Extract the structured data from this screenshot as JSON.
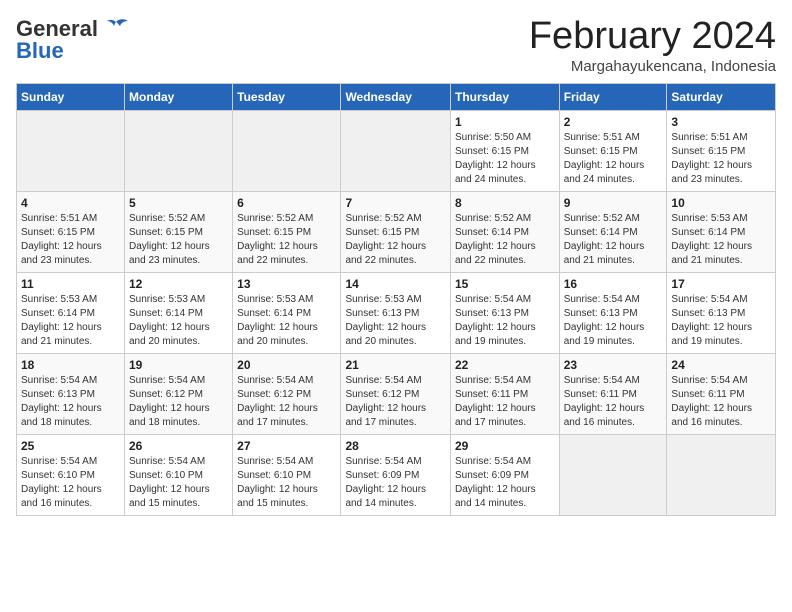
{
  "header": {
    "logo_general": "General",
    "logo_blue": "Blue",
    "month_title": "February 2024",
    "subtitle": "Margahayukencana, Indonesia"
  },
  "days_of_week": [
    "Sunday",
    "Monday",
    "Tuesday",
    "Wednesday",
    "Thursday",
    "Friday",
    "Saturday"
  ],
  "weeks": [
    [
      {
        "day": "",
        "info": ""
      },
      {
        "day": "",
        "info": ""
      },
      {
        "day": "",
        "info": ""
      },
      {
        "day": "",
        "info": ""
      },
      {
        "day": "1",
        "info": "Sunrise: 5:50 AM\nSunset: 6:15 PM\nDaylight: 12 hours\nand 24 minutes."
      },
      {
        "day": "2",
        "info": "Sunrise: 5:51 AM\nSunset: 6:15 PM\nDaylight: 12 hours\nand 24 minutes."
      },
      {
        "day": "3",
        "info": "Sunrise: 5:51 AM\nSunset: 6:15 PM\nDaylight: 12 hours\nand 23 minutes."
      }
    ],
    [
      {
        "day": "4",
        "info": "Sunrise: 5:51 AM\nSunset: 6:15 PM\nDaylight: 12 hours\nand 23 minutes."
      },
      {
        "day": "5",
        "info": "Sunrise: 5:52 AM\nSunset: 6:15 PM\nDaylight: 12 hours\nand 23 minutes."
      },
      {
        "day": "6",
        "info": "Sunrise: 5:52 AM\nSunset: 6:15 PM\nDaylight: 12 hours\nand 22 minutes."
      },
      {
        "day": "7",
        "info": "Sunrise: 5:52 AM\nSunset: 6:15 PM\nDaylight: 12 hours\nand 22 minutes."
      },
      {
        "day": "8",
        "info": "Sunrise: 5:52 AM\nSunset: 6:14 PM\nDaylight: 12 hours\nand 22 minutes."
      },
      {
        "day": "9",
        "info": "Sunrise: 5:52 AM\nSunset: 6:14 PM\nDaylight: 12 hours\nand 21 minutes."
      },
      {
        "day": "10",
        "info": "Sunrise: 5:53 AM\nSunset: 6:14 PM\nDaylight: 12 hours\nand 21 minutes."
      }
    ],
    [
      {
        "day": "11",
        "info": "Sunrise: 5:53 AM\nSunset: 6:14 PM\nDaylight: 12 hours\nand 21 minutes."
      },
      {
        "day": "12",
        "info": "Sunrise: 5:53 AM\nSunset: 6:14 PM\nDaylight: 12 hours\nand 20 minutes."
      },
      {
        "day": "13",
        "info": "Sunrise: 5:53 AM\nSunset: 6:14 PM\nDaylight: 12 hours\nand 20 minutes."
      },
      {
        "day": "14",
        "info": "Sunrise: 5:53 AM\nSunset: 6:13 PM\nDaylight: 12 hours\nand 20 minutes."
      },
      {
        "day": "15",
        "info": "Sunrise: 5:54 AM\nSunset: 6:13 PM\nDaylight: 12 hours\nand 19 minutes."
      },
      {
        "day": "16",
        "info": "Sunrise: 5:54 AM\nSunset: 6:13 PM\nDaylight: 12 hours\nand 19 minutes."
      },
      {
        "day": "17",
        "info": "Sunrise: 5:54 AM\nSunset: 6:13 PM\nDaylight: 12 hours\nand 19 minutes."
      }
    ],
    [
      {
        "day": "18",
        "info": "Sunrise: 5:54 AM\nSunset: 6:13 PM\nDaylight: 12 hours\nand 18 minutes."
      },
      {
        "day": "19",
        "info": "Sunrise: 5:54 AM\nSunset: 6:12 PM\nDaylight: 12 hours\nand 18 minutes."
      },
      {
        "day": "20",
        "info": "Sunrise: 5:54 AM\nSunset: 6:12 PM\nDaylight: 12 hours\nand 17 minutes."
      },
      {
        "day": "21",
        "info": "Sunrise: 5:54 AM\nSunset: 6:12 PM\nDaylight: 12 hours\nand 17 minutes."
      },
      {
        "day": "22",
        "info": "Sunrise: 5:54 AM\nSunset: 6:11 PM\nDaylight: 12 hours\nand 17 minutes."
      },
      {
        "day": "23",
        "info": "Sunrise: 5:54 AM\nSunset: 6:11 PM\nDaylight: 12 hours\nand 16 minutes."
      },
      {
        "day": "24",
        "info": "Sunrise: 5:54 AM\nSunset: 6:11 PM\nDaylight: 12 hours\nand 16 minutes."
      }
    ],
    [
      {
        "day": "25",
        "info": "Sunrise: 5:54 AM\nSunset: 6:10 PM\nDaylight: 12 hours\nand 16 minutes."
      },
      {
        "day": "26",
        "info": "Sunrise: 5:54 AM\nSunset: 6:10 PM\nDaylight: 12 hours\nand 15 minutes."
      },
      {
        "day": "27",
        "info": "Sunrise: 5:54 AM\nSunset: 6:10 PM\nDaylight: 12 hours\nand 15 minutes."
      },
      {
        "day": "28",
        "info": "Sunrise: 5:54 AM\nSunset: 6:09 PM\nDaylight: 12 hours\nand 14 minutes."
      },
      {
        "day": "29",
        "info": "Sunrise: 5:54 AM\nSunset: 6:09 PM\nDaylight: 12 hours\nand 14 minutes."
      },
      {
        "day": "",
        "info": ""
      },
      {
        "day": "",
        "info": ""
      }
    ]
  ]
}
